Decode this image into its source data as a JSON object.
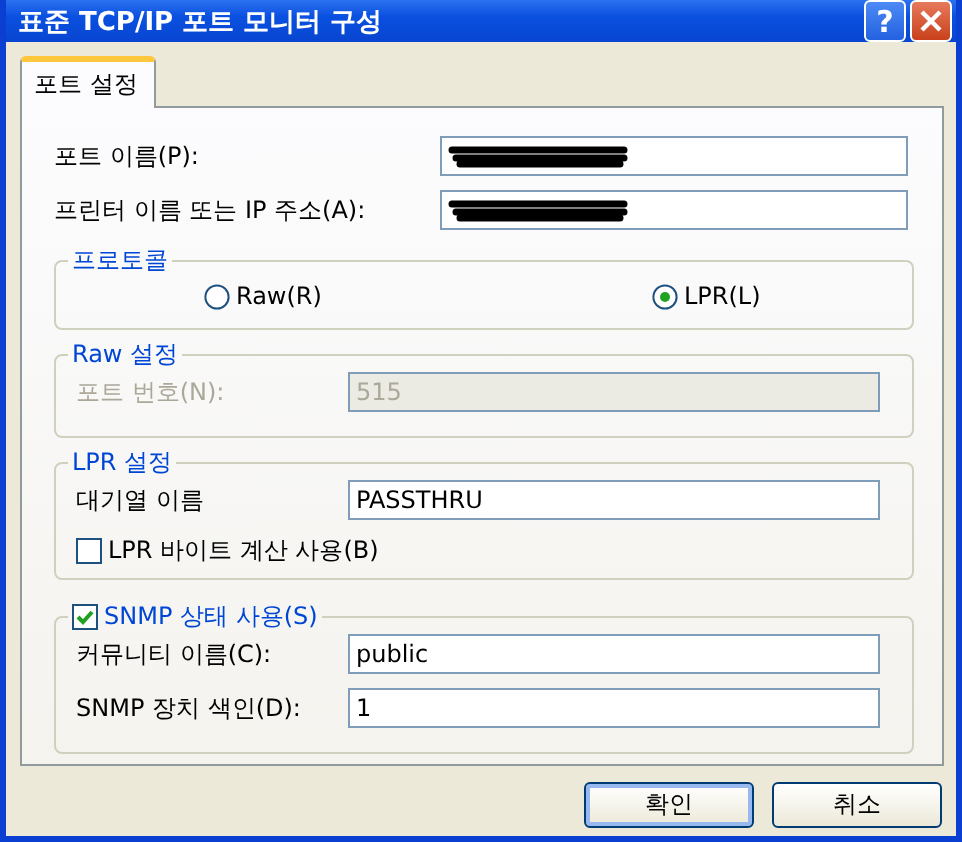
{
  "window": {
    "title": "표준 TCP/IP 포트 모니터 구성",
    "help": "?"
  },
  "tabs": [
    {
      "label": "포트 설정",
      "selected": true
    }
  ],
  "fields": [
    {
      "label": "포트 이름(P):",
      "redacted": true
    },
    {
      "label": "프린터 이름 또는 IP 주소(A):",
      "redacted": true
    }
  ],
  "protocol": {
    "title": "프로토콜",
    "options": [
      {
        "label": "Raw(R)",
        "selected": false
      },
      {
        "label": "LPR(L)",
        "selected": true
      }
    ]
  },
  "raw_settings": {
    "title": "Raw 설정",
    "disabled": true,
    "fields": [
      {
        "label": "포트 번호(N):",
        "value": "515"
      }
    ]
  },
  "lpr_settings": {
    "title": "LPR 설정",
    "disabled": false,
    "fields": [
      {
        "label": "대기열 이름",
        "value": "PASSTHRU"
      }
    ],
    "checkbox": {
      "label": "LPR 바이트 계산 사용(B)",
      "checked": false
    }
  },
  "snmp": {
    "label": "SNMP 상태 사용(S)",
    "checked": true,
    "fields": [
      {
        "label": "커뮤니티 이름(C):",
        "value": "public"
      },
      {
        "label": "SNMP 장치 색인(D):",
        "value": "1"
      }
    ]
  },
  "buttons": [
    {
      "label": "확인",
      "default": true
    },
    {
      "label": "취소",
      "default": false
    }
  ]
}
